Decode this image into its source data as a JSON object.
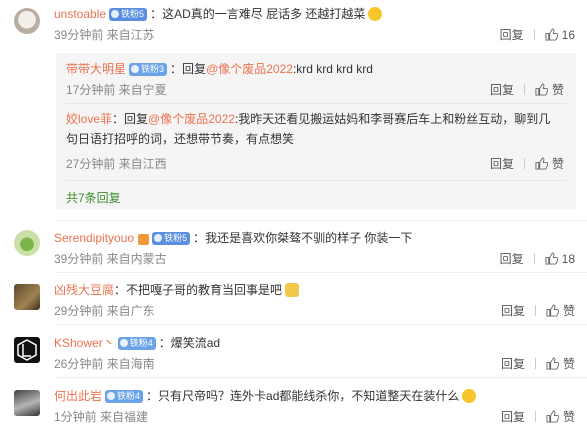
{
  "comments": [
    {
      "user": "unstoable",
      "badge": "铁粉5",
      "text": "这AD真的一言难尽 屁话多 还越打越菜",
      "meta": "39分钟前 来自江苏",
      "reply": "回复",
      "likes": "16"
    },
    {
      "user": "Serendipityouo",
      "badge": "铁粉5",
      "text": "我还是喜欢你桀骜不驯的样子 你装一下",
      "meta": "39分钟前 来自内蒙古",
      "reply": "回复",
      "likes": "18"
    },
    {
      "user": "凶残大豆腐",
      "text": "不把嘎子哥的教育当回事是吧",
      "meta": "29分钟前 来自广东",
      "reply": "回复",
      "likes": "赞"
    },
    {
      "user": "KShower丶",
      "badge": "铁粉4",
      "text": "爆笑流ad",
      "meta": "26分钟前 来自海南",
      "reply": "回复",
      "likes": "赞"
    },
    {
      "user": "何出此岩",
      "badge": "铁粉4",
      "text": "只有尺帝吗？连外卡ad都能线杀你，不知道整天在装什么",
      "meta": "1分钟前 来自福建",
      "reply": "回复",
      "likes": "赞"
    }
  ],
  "sub_replies": [
    {
      "user": "带带大明星",
      "badge": "铁粉3",
      "prefix": "回复",
      "mention": "@像个废品2022",
      "text": ":krd krd krd krd",
      "meta": "17分钟前 来自宁夏",
      "reply": "回复",
      "likes": "赞"
    },
    {
      "user": "姣love菲",
      "prefix": "回复",
      "mention": "@像个废品2022",
      "text1": ":我昨天还看见搬运姑妈和李哥赛后车上和粉丝互动，聊到几",
      "text2": "句日语打招呼的词，还想带节奏，有点想笑",
      "meta": "27分钟前 来自江西",
      "reply": "回复",
      "likes": "赞"
    }
  ],
  "more_replies": "共7条回复"
}
